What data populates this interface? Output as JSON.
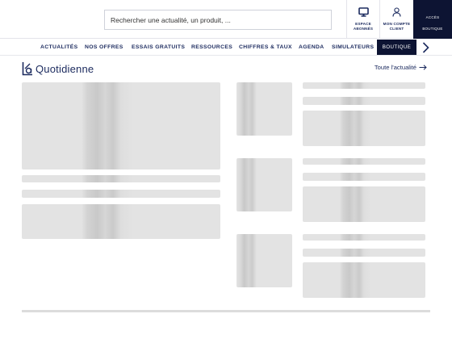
{
  "search": {
    "placeholder": "Rechercher une actualité, un produit, ..."
  },
  "header_accounts": {
    "subscribers": {
      "line1": "ESPACE",
      "line2": "ABONNÉS",
      "icon": "monitor-icon"
    },
    "client": {
      "line1": "MON COMPTE",
      "line2": "CLIENT",
      "icon": "user-icon"
    },
    "shop": {
      "line1": "ACCÈS",
      "line2": "BOUTIQUE"
    }
  },
  "nav": {
    "items": [
      {
        "label": "ACTUALITÉS"
      },
      {
        "label": "NOS OFFRES"
      },
      {
        "label": "ESSAIS GRATUITS"
      },
      {
        "label": "RESSOURCES"
      },
      {
        "label": "CHIFFRES & TAUX"
      },
      {
        "label": "AGENDA"
      },
      {
        "label": "SIMULATEURS"
      }
    ],
    "shop_label": "BOUTIQUE",
    "next_icon": "chevron-right-icon"
  },
  "section": {
    "title": "Quotidienne",
    "logo_letter": "L",
    "link_label": "Toute l'actualité",
    "link_icon": "arrow-right-icon"
  },
  "colors": {
    "navy": "#1b2a5e",
    "dark": "#0d1433",
    "skeleton": "#e3e3e3"
  }
}
